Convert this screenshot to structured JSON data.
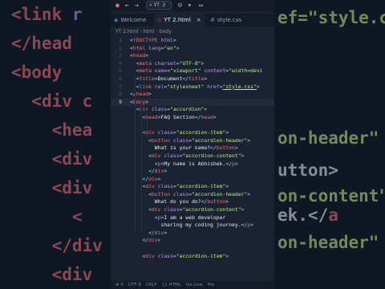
{
  "background_left": [
    {
      "parts": [
        {
          "c": "t",
          "v": "<link "
        },
        {
          "c": "a",
          "v": "r"
        }
      ]
    },
    {
      "parts": [
        {
          "c": "t",
          "v": "</head"
        }
      ]
    },
    {
      "parts": [
        {
          "c": "t",
          "v": "<body"
        }
      ]
    },
    {
      "parts": [
        {
          "c": "w",
          "v": "  "
        },
        {
          "c": "t",
          "v": "<div c"
        }
      ]
    },
    {
      "parts": [
        {
          "c": "w",
          "v": "    "
        },
        {
          "c": "t",
          "v": "<hea"
        }
      ]
    },
    {
      "parts": [
        {
          "c": "w",
          "v": "    "
        },
        {
          "c": "t",
          "v": "<div"
        }
      ]
    },
    {
      "parts": [
        {
          "c": "w",
          "v": "    "
        },
        {
          "c": "t",
          "v": "<div"
        }
      ]
    },
    {
      "parts": [
        {
          "c": "w",
          "v": "      "
        },
        {
          "c": "t",
          "v": "<"
        }
      ]
    },
    {
      "parts": [
        {
          "c": "w",
          "v": "    "
        },
        {
          "c": "t",
          "v": "</div"
        }
      ]
    },
    {
      "parts": [
        {
          "c": "w",
          "v": "    "
        },
        {
          "c": "t",
          "v": "<div"
        }
      ]
    }
  ],
  "background_right": [
    {
      "parts": [
        {
          "c": "s",
          "v": "ef=\"style.css\""
        }
      ]
    },
    {
      "parts": [
        {
          "c": "s",
          "v": "on-header\""
        }
      ]
    },
    {
      "parts": [
        {
          "c": "w",
          "v": "utton>"
        }
      ]
    },
    {
      "parts": [
        {
          "c": "s",
          "v": "on-content\""
        }
      ]
    },
    {
      "parts": [
        {
          "c": "w",
          "v": "ek.</"
        },
        {
          "c": "t",
          "v": "a"
        }
      ]
    },
    {
      "parts": [
        {
          "c": "s",
          "v": "on-header\""
        }
      ]
    }
  ],
  "titlebar": {
    "search_text": "YT 2"
  },
  "tabs": [
    {
      "label": "Welcome",
      "icon": "vscode-icon"
    },
    {
      "label": "YT 2.html",
      "icon": "html-icon",
      "close": "×"
    },
    {
      "label": "style.css",
      "icon": "css-icon"
    }
  ],
  "breadcrumb": [
    "YT 2.html",
    "html",
    "body"
  ],
  "code_lines": [
    {
      "n": "1",
      "parts": [
        {
          "c": "p",
          "v": "<!"
        },
        {
          "c": "t",
          "v": "DOCTYPE"
        },
        {
          "c": "a",
          "v": " html"
        },
        {
          "c": "p",
          "v": ">"
        }
      ]
    },
    {
      "n": "2",
      "parts": [
        {
          "c": "p",
          "v": "<"
        },
        {
          "c": "t",
          "v": "html"
        },
        {
          "c": "a",
          "v": " lang"
        },
        {
          "c": "p",
          "v": "="
        },
        {
          "c": "s",
          "v": "\"en\""
        },
        {
          "c": "p",
          "v": ">"
        }
      ]
    },
    {
      "n": "3",
      "parts": [
        {
          "c": "p",
          "v": "<"
        },
        {
          "c": "t",
          "v": "head"
        },
        {
          "c": "p",
          "v": ">"
        }
      ]
    },
    {
      "n": "4",
      "parts": [
        {
          "c": "w",
          "v": "  "
        },
        {
          "c": "p",
          "v": "<"
        },
        {
          "c": "t",
          "v": "meta"
        },
        {
          "c": "a",
          "v": " charset"
        },
        {
          "c": "p",
          "v": "="
        },
        {
          "c": "s",
          "v": "\"UTF-8\""
        },
        {
          "c": "p",
          "v": ">"
        }
      ]
    },
    {
      "n": "5",
      "parts": [
        {
          "c": "w",
          "v": "  "
        },
        {
          "c": "p",
          "v": "<"
        },
        {
          "c": "t",
          "v": "meta"
        },
        {
          "c": "a",
          "v": " name"
        },
        {
          "c": "p",
          "v": "="
        },
        {
          "c": "s",
          "v": "\"viewport\""
        },
        {
          "c": "a",
          "v": " content"
        },
        {
          "c": "p",
          "v": "="
        },
        {
          "c": "s",
          "v": "\"width=devi"
        }
      ]
    },
    {
      "n": "6",
      "parts": [
        {
          "c": "w",
          "v": "  "
        },
        {
          "c": "p",
          "v": "<"
        },
        {
          "c": "t",
          "v": "title"
        },
        {
          "c": "p",
          "v": ">"
        },
        {
          "c": "w",
          "v": "Document"
        },
        {
          "c": "p",
          "v": "</"
        },
        {
          "c": "t",
          "v": "title"
        },
        {
          "c": "p",
          "v": ">"
        }
      ]
    },
    {
      "n": "7",
      "parts": [
        {
          "c": "w",
          "v": "  "
        },
        {
          "c": "p",
          "v": "<"
        },
        {
          "c": "t",
          "v": "link"
        },
        {
          "c": "a",
          "v": " rel"
        },
        {
          "c": "p",
          "v": "="
        },
        {
          "c": "s",
          "v": "\"stylesheet\""
        },
        {
          "c": "a",
          "v": " href"
        },
        {
          "c": "p",
          "v": "="
        },
        {
          "c": "s u",
          "v": "\"style.css\""
        },
        {
          "c": "p",
          "v": ">"
        }
      ]
    },
    {
      "n": "8",
      "parts": [
        {
          "c": "p",
          "v": "</"
        },
        {
          "c": "t",
          "v": "head"
        },
        {
          "c": "p",
          "v": ">"
        }
      ]
    },
    {
      "n": "9",
      "current": true,
      "parts": [
        {
          "c": "p",
          "v": "<"
        },
        {
          "c": "t",
          "v": "body"
        },
        {
          "c": "p",
          "v": ">"
        }
      ]
    },
    {
      "n": "",
      "parts": [
        {
          "c": "w",
          "v": "  "
        },
        {
          "c": "p",
          "v": "<"
        },
        {
          "c": "t",
          "v": "div"
        },
        {
          "c": "a",
          "v": " class"
        },
        {
          "c": "p",
          "v": "="
        },
        {
          "c": "s",
          "v": "\"accordion\""
        },
        {
          "c": "p",
          "v": ">"
        }
      ]
    },
    {
      "n": "",
      "parts": [
        {
          "c": "w",
          "v": "    "
        },
        {
          "c": "p",
          "v": "<"
        },
        {
          "c": "t",
          "v": "head"
        },
        {
          "c": "p",
          "v": ">"
        },
        {
          "c": "w",
          "v": "FAQ Section"
        },
        {
          "c": "p",
          "v": "</"
        },
        {
          "c": "t",
          "v": "head"
        },
        {
          "c": "p",
          "v": ">"
        }
      ]
    },
    {
      "n": "",
      "parts": []
    },
    {
      "n": "",
      "parts": [
        {
          "c": "w",
          "v": "    "
        },
        {
          "c": "p",
          "v": "<"
        },
        {
          "c": "t",
          "v": "div"
        },
        {
          "c": "a",
          "v": " class"
        },
        {
          "c": "p",
          "v": "="
        },
        {
          "c": "s",
          "v": "\"accordion-item\""
        },
        {
          "c": "p",
          "v": ">"
        }
      ]
    },
    {
      "n": "",
      "parts": [
        {
          "c": "w",
          "v": "      "
        },
        {
          "c": "p",
          "v": "<"
        },
        {
          "c": "t",
          "v": "button"
        },
        {
          "c": "a",
          "v": " class"
        },
        {
          "c": "p",
          "v": "="
        },
        {
          "c": "s",
          "v": "\"accordion-header\""
        },
        {
          "c": "p",
          "v": ">"
        }
      ]
    },
    {
      "n": "",
      "parts": [
        {
          "c": "w",
          "v": "        What is your name?"
        },
        {
          "c": "p",
          "v": "</"
        },
        {
          "c": "t",
          "v": "button"
        },
        {
          "c": "p",
          "v": ">"
        }
      ]
    },
    {
      "n": "",
      "parts": [
        {
          "c": "w",
          "v": "      "
        },
        {
          "c": "p",
          "v": "<"
        },
        {
          "c": "t",
          "v": "div"
        },
        {
          "c": "a",
          "v": " class"
        },
        {
          "c": "p",
          "v": "="
        },
        {
          "c": "s",
          "v": "\"accordion-content\""
        },
        {
          "c": "p",
          "v": ">"
        }
      ]
    },
    {
      "n": "",
      "parts": [
        {
          "c": "w",
          "v": "        "
        },
        {
          "c": "p",
          "v": "<"
        },
        {
          "c": "t",
          "v": "p"
        },
        {
          "c": "p",
          "v": ">"
        },
        {
          "c": "w",
          "v": "My name is Abhishek."
        },
        {
          "c": "p",
          "v": "</"
        },
        {
          "c": "t",
          "v": "p"
        },
        {
          "c": "p",
          "v": ">"
        }
      ]
    },
    {
      "n": "",
      "parts": [
        {
          "c": "w",
          "v": "      "
        },
        {
          "c": "p",
          "v": "</"
        },
        {
          "c": "t",
          "v": "div"
        },
        {
          "c": "p",
          "v": ">"
        }
      ]
    },
    {
      "n": "",
      "parts": [
        {
          "c": "w",
          "v": "    "
        },
        {
          "c": "p",
          "v": "</"
        },
        {
          "c": "t",
          "v": "div"
        },
        {
          "c": "p",
          "v": ">"
        }
      ]
    },
    {
      "n": "",
      "parts": [
        {
          "c": "w",
          "v": "    "
        },
        {
          "c": "p",
          "v": "<"
        },
        {
          "c": "t",
          "v": "div"
        },
        {
          "c": "a",
          "v": " class"
        },
        {
          "c": "p",
          "v": "="
        },
        {
          "c": "s",
          "v": "\"accordion-item\""
        },
        {
          "c": "p",
          "v": ">"
        }
      ]
    },
    {
      "n": "",
      "parts": [
        {
          "c": "w",
          "v": "      "
        },
        {
          "c": "p",
          "v": "<"
        },
        {
          "c": "t",
          "v": "button"
        },
        {
          "c": "a",
          "v": " class"
        },
        {
          "c": "p",
          "v": "="
        },
        {
          "c": "s",
          "v": "\"accordion-header\""
        },
        {
          "c": "p",
          "v": ">"
        }
      ]
    },
    {
      "n": "",
      "parts": [
        {
          "c": "w",
          "v": "        What do you do?"
        },
        {
          "c": "p",
          "v": "</"
        },
        {
          "c": "t",
          "v": "button"
        },
        {
          "c": "p",
          "v": ">"
        }
      ]
    },
    {
      "n": "",
      "parts": [
        {
          "c": "w",
          "v": "      "
        },
        {
          "c": "p",
          "v": "<"
        },
        {
          "c": "t",
          "v": "div"
        },
        {
          "c": "a",
          "v": " class"
        },
        {
          "c": "p",
          "v": "="
        },
        {
          "c": "s",
          "v": "\"accordion-content\""
        },
        {
          "c": "p",
          "v": ">"
        }
      ]
    },
    {
      "n": "",
      "parts": [
        {
          "c": "w",
          "v": "        "
        },
        {
          "c": "p",
          "v": "<"
        },
        {
          "c": "t",
          "v": "p"
        },
        {
          "c": "p",
          "v": ">"
        },
        {
          "c": "w",
          "v": "I am a web developer"
        }
      ]
    },
    {
      "n": "",
      "parts": [
        {
          "c": "w",
          "v": "          sharing my coding journey."
        },
        {
          "c": "p",
          "v": "</"
        },
        {
          "c": "t",
          "v": "p"
        },
        {
          "c": "p",
          "v": ">"
        }
      ]
    },
    {
      "n": "",
      "parts": [
        {
          "c": "w",
          "v": "      "
        },
        {
          "c": "p",
          "v": "</"
        },
        {
          "c": "t",
          "v": "div"
        },
        {
          "c": "p",
          "v": ">"
        }
      ]
    },
    {
      "n": "",
      "parts": [
        {
          "c": "w",
          "v": "    "
        },
        {
          "c": "p",
          "v": "</"
        },
        {
          "c": "t",
          "v": "div"
        },
        {
          "c": "p",
          "v": ">"
        }
      ]
    },
    {
      "n": "",
      "parts": []
    },
    {
      "n": "",
      "parts": [
        {
          "c": "w",
          "v": "    "
        },
        {
          "c": "p",
          "v": "<"
        },
        {
          "c": "t",
          "v": "div"
        },
        {
          "c": "a",
          "v": " class"
        },
        {
          "c": "p",
          "v": "="
        },
        {
          "c": "s",
          "v": "\"accordion-item\""
        },
        {
          "c": "p",
          "v": ">"
        }
      ]
    }
  ],
  "statusbar": [
    "⊗ 0",
    "UTF-8",
    "CRLF",
    "{} HTML",
    "Go Live",
    "Pre"
  ],
  "colors": {
    "editor_bg": "#1b2232",
    "tag": "#f07178",
    "attr": "#c792ea",
    "string": "#c3e88d",
    "punct": "#89ddff",
    "text": "#e6e9f0"
  }
}
